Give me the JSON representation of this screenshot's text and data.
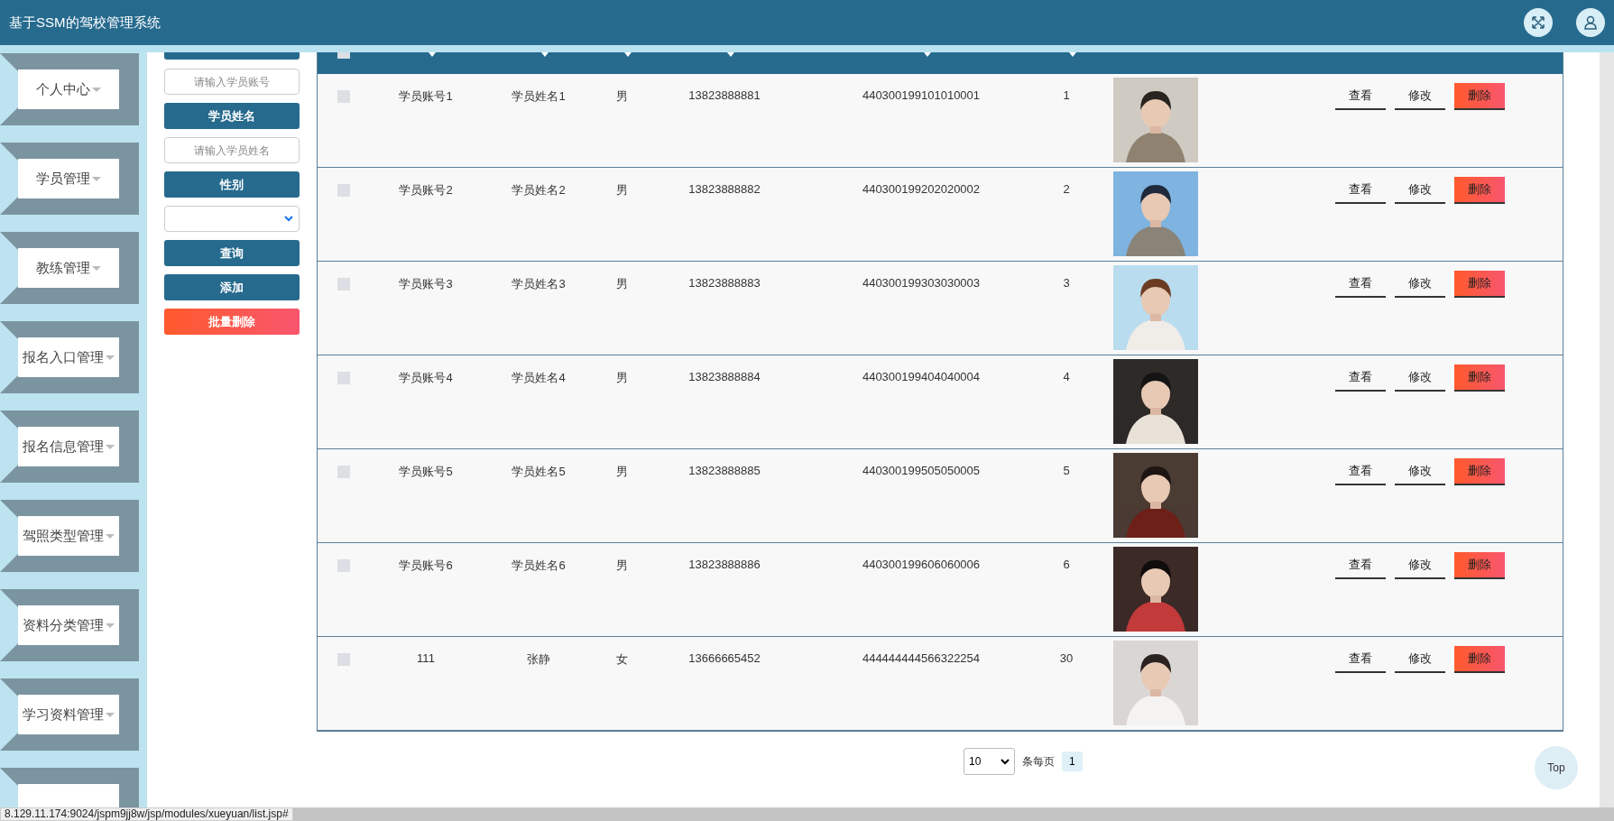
{
  "header": {
    "title": "基于SSM的驾校管理系统"
  },
  "sidebar": {
    "items": [
      {
        "label": "个人中心"
      },
      {
        "label": "学员管理"
      },
      {
        "label": "教练管理"
      },
      {
        "label": "报名入口管理"
      },
      {
        "label": "报名信息管理"
      },
      {
        "label": "驾照类型管理"
      },
      {
        "label": "资料分类管理"
      },
      {
        "label": "学习资料管理"
      }
    ]
  },
  "filters": [
    {
      "kind": "cut"
    },
    {
      "kind": "input",
      "placeholder": "请输入学员账号"
    },
    {
      "kind": "label",
      "text": "学员姓名"
    },
    {
      "kind": "input",
      "placeholder": "请输入学员姓名"
    },
    {
      "kind": "label",
      "text": "性别"
    },
    {
      "kind": "select"
    },
    {
      "kind": "button",
      "text": "查询"
    },
    {
      "kind": "button",
      "text": "添加"
    },
    {
      "kind": "danger",
      "text": "批量删除"
    }
  ],
  "table": {
    "header": {
      "checked": false
    },
    "rows": [
      {
        "checked": false,
        "account": "学员账号1",
        "name": "学员姓名1",
        "gender": "男",
        "phone": "13823888881",
        "id_number": "440300199101010001",
        "age": "1",
        "actions": [
          "查看",
          "修改",
          "删除"
        ]
      },
      {
        "checked": false,
        "account": "学员账号2",
        "name": "学员姓名2",
        "gender": "男",
        "phone": "13823888882",
        "id_number": "440300199202020002",
        "age": "2",
        "actions": [
          "查看",
          "修改",
          "删除"
        ]
      },
      {
        "checked": false,
        "account": "学员账号3",
        "name": "学员姓名3",
        "gender": "男",
        "phone": "13823888883",
        "id_number": "440300199303030003",
        "age": "3",
        "actions": [
          "查看",
          "修改",
          "删除"
        ]
      },
      {
        "checked": false,
        "account": "学员账号4",
        "name": "学员姓名4",
        "gender": "男",
        "phone": "13823888884",
        "id_number": "440300199404040004",
        "age": "4",
        "actions": [
          "查看",
          "修改",
          "删除"
        ]
      },
      {
        "checked": false,
        "account": "学员账号5",
        "name": "学员姓名5",
        "gender": "男",
        "phone": "13823888885",
        "id_number": "440300199505050005",
        "age": "5",
        "actions": [
          "查看",
          "修改",
          "删除"
        ]
      },
      {
        "checked": false,
        "account": "学员账号6",
        "name": "学员姓名6",
        "gender": "男",
        "phone": "13823888886",
        "id_number": "440300199606060006",
        "age": "6",
        "actions": [
          "查看",
          "修改",
          "删除"
        ]
      },
      {
        "checked": false,
        "account": "111",
        "name": "张静",
        "gender": "女",
        "phone": "13666665452",
        "id_number": "444444444566322254",
        "age": "30",
        "actions": [
          "查看",
          "修改",
          "删除"
        ]
      }
    ]
  },
  "pagination": {
    "page_size": "10",
    "per_page_label": "条每页",
    "pages": [
      {
        "label": "1",
        "selected": true
      }
    ]
  },
  "top_button": "Top",
  "status_url": "8.129.11.174:9024/jspm9jj8w/jsp/modules/xueyuan/list.jsp#"
}
